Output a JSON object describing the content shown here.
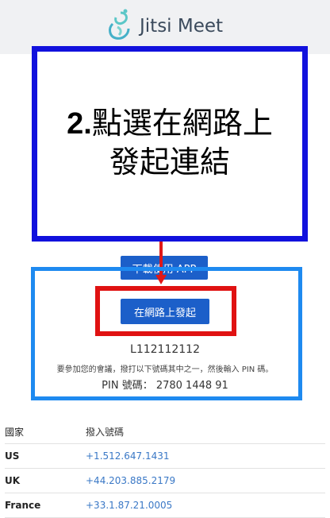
{
  "header": {
    "app_name": "Jitsi Meet"
  },
  "annotation": {
    "step_number": "2.",
    "line1": "點選在網路上",
    "line2": "發起連結"
  },
  "buttons": {
    "download_app": "下載使用 APP",
    "start_on_web": "在網路上發起"
  },
  "meeting": {
    "room_id": "L112112112",
    "instructions": "要參加您的會議，撥打以下號碼其中之一，然後輸入 PIN 碼。",
    "pin_label": "PIN 號碼：",
    "pin_value": "2780 1448 91"
  },
  "dial_table": {
    "headers": [
      "國家",
      "撥入號碼"
    ],
    "rows": [
      {
        "country": "US",
        "number": "+1.512.647.1431"
      },
      {
        "country": "UK",
        "number": "+44.203.885.2179"
      },
      {
        "country": "France",
        "number": "+33.1.87.21.0005"
      }
    ]
  },
  "colors": {
    "primary_button": "#1c5fc9",
    "annotation_blue": "#1111dd",
    "highlight_red": "#e01212",
    "highlight_light_blue": "#1e8af0",
    "link": "#3a78c6"
  }
}
